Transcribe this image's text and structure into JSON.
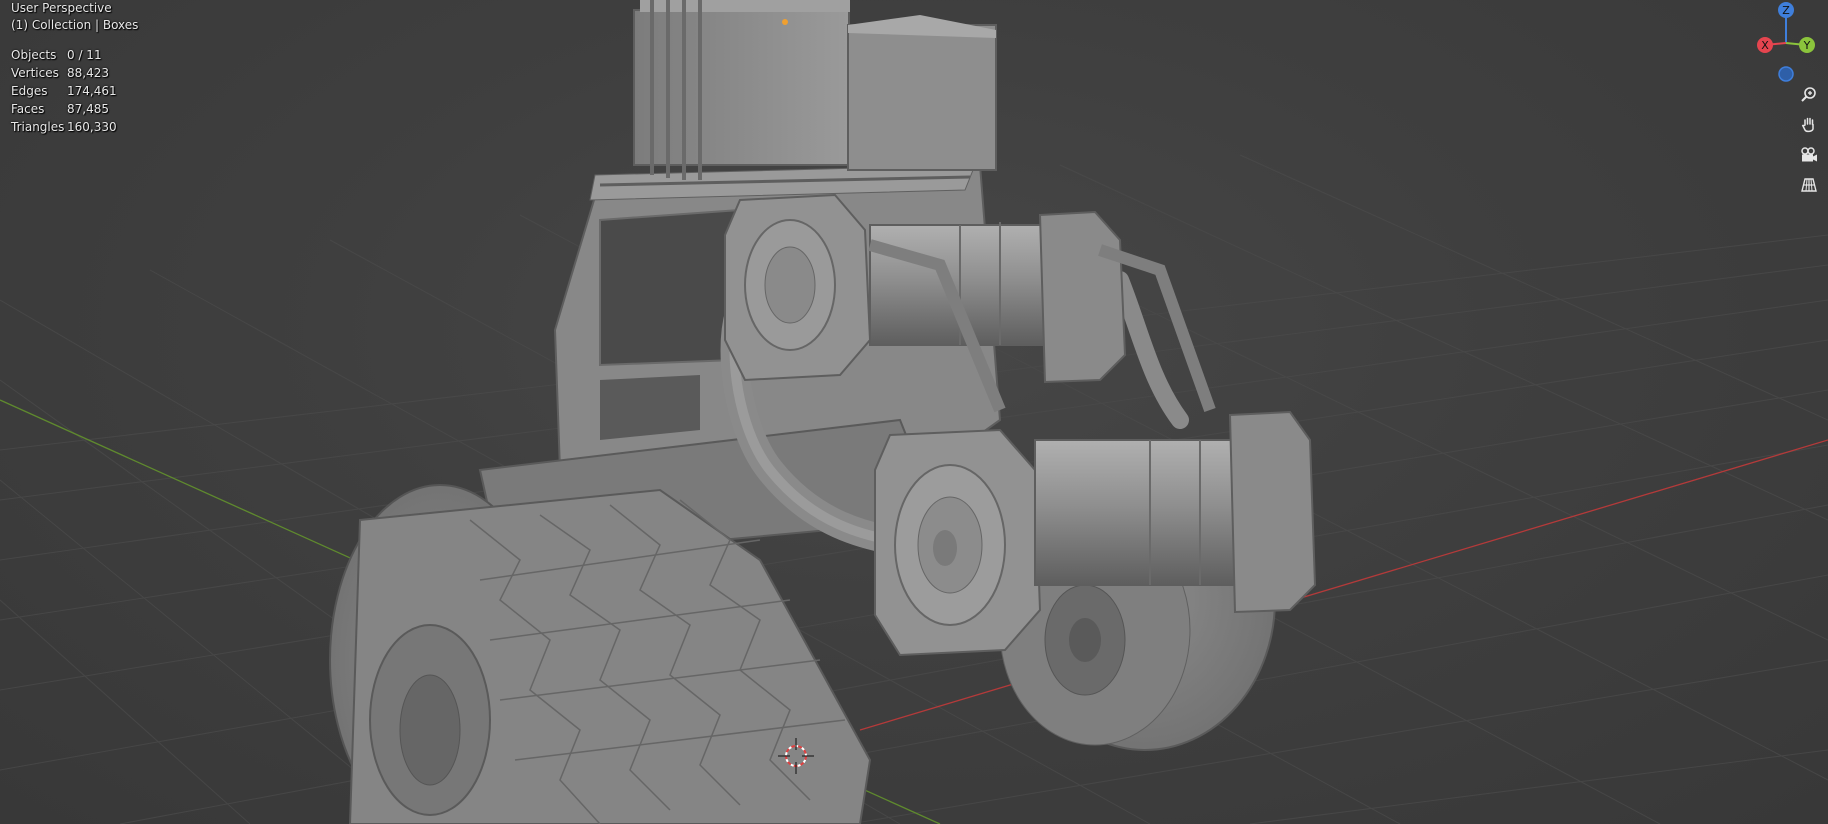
{
  "viewport": {
    "view_name": "User Perspective",
    "collection_line": "(1) Collection | Boxes"
  },
  "stats": [
    {
      "label": "Objects",
      "value": "0 / 11"
    },
    {
      "label": "Vertices",
      "value": "88,423"
    },
    {
      "label": "Edges",
      "value": "174,461"
    },
    {
      "label": "Faces",
      "value": "87,485"
    },
    {
      "label": "Triangles",
      "value": "160,330"
    }
  ],
  "gizmo": {
    "z_label": "Z",
    "x_label": "X",
    "y_label": "Y",
    "colors": {
      "x": "#e5454f",
      "y": "#8bc43c",
      "z": "#3f7fdc"
    }
  },
  "nav_tools": [
    {
      "icon": "zoom-icon"
    },
    {
      "icon": "hand-pan-icon"
    },
    {
      "icon": "camera-view-icon"
    },
    {
      "icon": "perspective-grid-icon"
    }
  ],
  "colors": {
    "background": "#3d3d3d",
    "grid": "#4a4a4a",
    "x_axis": "#b43a3a",
    "y_axis": "#5f8a2e",
    "model": "#8f8f8f"
  }
}
